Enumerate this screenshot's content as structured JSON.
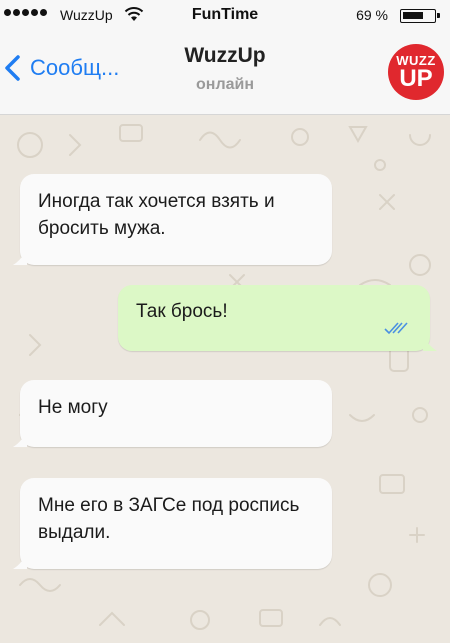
{
  "status_bar": {
    "carrier": "WuzzUp",
    "time": "FunTime",
    "battery_percent": "69 %",
    "battery_level": 0.69,
    "signal_icon": "signal-dots-icon",
    "wifi_icon": "wifi-icon"
  },
  "nav": {
    "back_label": "Сообщ...",
    "back_icon": "chevron-left-icon",
    "title": "WuzzUp",
    "status": "онлайн",
    "avatar_line1": "WUZZ",
    "avatar_line2": "UP"
  },
  "messages": [
    {
      "direction": "incoming",
      "text": "Иногда так хочется взять и бросить мужа."
    },
    {
      "direction": "outgoing",
      "text": "Так брось!",
      "read_icon": "double-check-icon"
    },
    {
      "direction": "incoming",
      "text": "Не могу"
    },
    {
      "direction": "incoming",
      "text": "Мне его в ЗАГСе под роспись выдали."
    }
  ],
  "colors": {
    "accent": "#1f7df2",
    "incoming_bubble": "#fafafa",
    "outgoing_bubble": "#dcf8c6",
    "chat_background": "#ece7df",
    "avatar": "#e0282e",
    "read_ticks": "#4a90e2"
  }
}
